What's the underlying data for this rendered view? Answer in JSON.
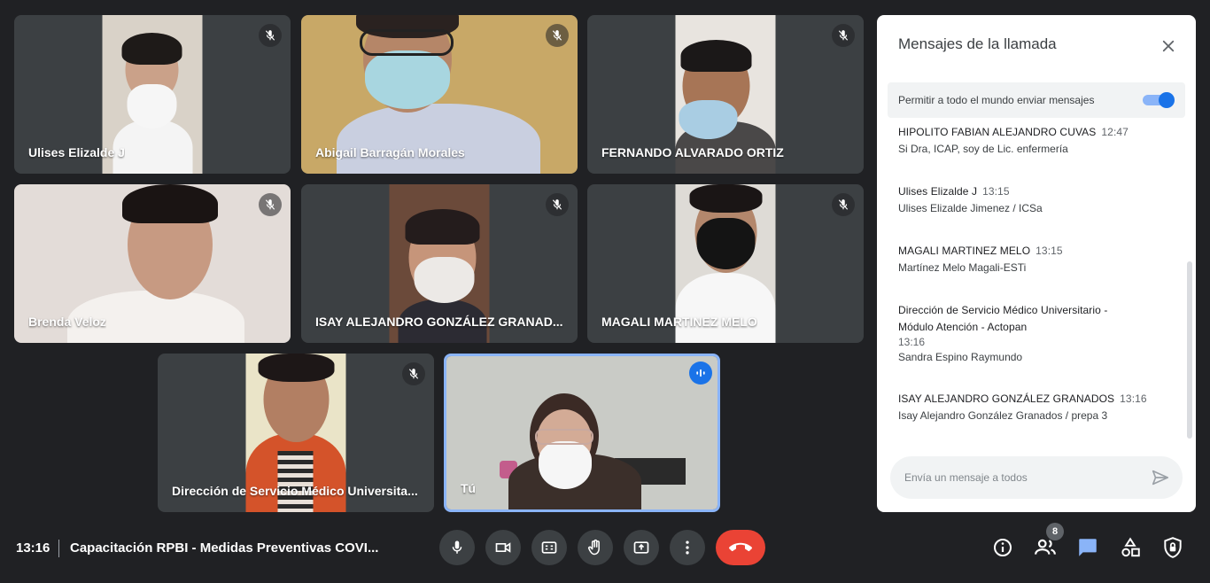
{
  "tiles": [
    {
      "name": "Ulises Elizalde J"
    },
    {
      "name": "Abigail Barragán Morales"
    },
    {
      "name": "FERNANDO ALVARADO ORTIZ"
    },
    {
      "name": "Brenda Veloz"
    },
    {
      "name": "ISAY ALEJANDRO GONZÁLEZ GRANAD..."
    },
    {
      "name": "MAGALI MARTINEZ MELO"
    },
    {
      "name": "Dirección de Servicio Médico Universita..."
    },
    {
      "name": "Tú"
    }
  ],
  "chat": {
    "title": "Mensajes de la llamada",
    "permit_label": "Permitir a todo el mundo enviar mensajes",
    "permit_enabled": true,
    "messages": [
      {
        "sender": "HIPOLITO FABIAN ALEJANDRO CUVAS",
        "time": "12:47",
        "text": "Si Dra, ICAP, soy de Lic. enfermería"
      },
      {
        "sender": "Ulises Elizalde J",
        "time": "13:15",
        "text": "Ulises Elizalde Jimenez / ICSa"
      },
      {
        "sender": "MAGALI MARTINEZ MELO",
        "time": "13:15",
        "text": "Martínez Melo Magali-ESTi"
      },
      {
        "sender_line1": "Dirección de Servicio Médico Universitario -",
        "sender_line2": "Módulo Atención - Actopan",
        "time": "13:16",
        "text": "Sandra Espino Raymundo"
      },
      {
        "sender": "ISAY ALEJANDRO GONZÁLEZ GRANADOS",
        "time": "13:16",
        "text": "Isay Alejandro González Granados / prepa 3"
      }
    ],
    "input_placeholder": "Envía un mensaje a todos"
  },
  "bottom": {
    "time": "13:16",
    "meeting_title": "Capacitación RPBI - Medidas Preventivas COVI...",
    "participants_count": "8"
  },
  "icons": {
    "mic": "mic-icon",
    "camera": "camera-icon",
    "captions": "captions-icon",
    "hand": "raise-hand-icon",
    "present": "present-icon",
    "more": "more-vert-icon",
    "end": "end-call-icon",
    "info": "info-icon",
    "people": "people-icon",
    "chat": "chat-icon",
    "activities": "activities-icon",
    "lock": "host-controls-icon"
  },
  "colors": {
    "end_call": "#ea4335",
    "accent": "#1a73e8",
    "background": "#202124",
    "tile": "#3c4043"
  }
}
